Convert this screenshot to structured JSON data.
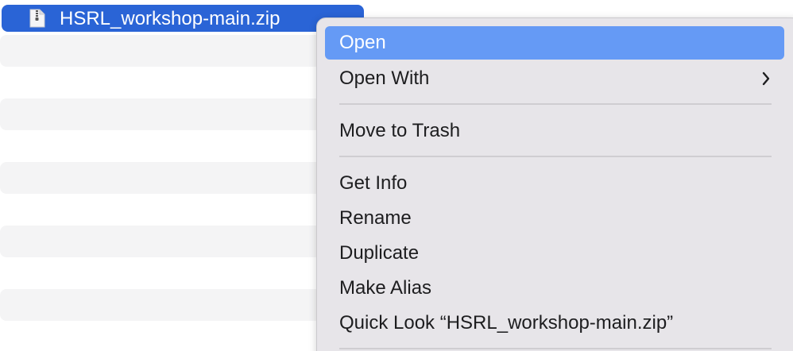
{
  "file": {
    "name": "HSRL_workshop-main.zip",
    "icon": "zip-file-icon"
  },
  "context_menu": {
    "items": [
      {
        "label": "Open"
      },
      {
        "label": "Open With"
      },
      {
        "label": "Move to Trash"
      },
      {
        "label": "Get Info"
      },
      {
        "label": "Rename"
      },
      {
        "label": "Duplicate"
      },
      {
        "label": "Make Alias"
      },
      {
        "label": "Quick Look “HSRL_workshop-main.zip”"
      }
    ]
  },
  "colors": {
    "selection": "#2a64d6",
    "highlight": "#659af5",
    "menu_background": "#e7e5e9"
  }
}
